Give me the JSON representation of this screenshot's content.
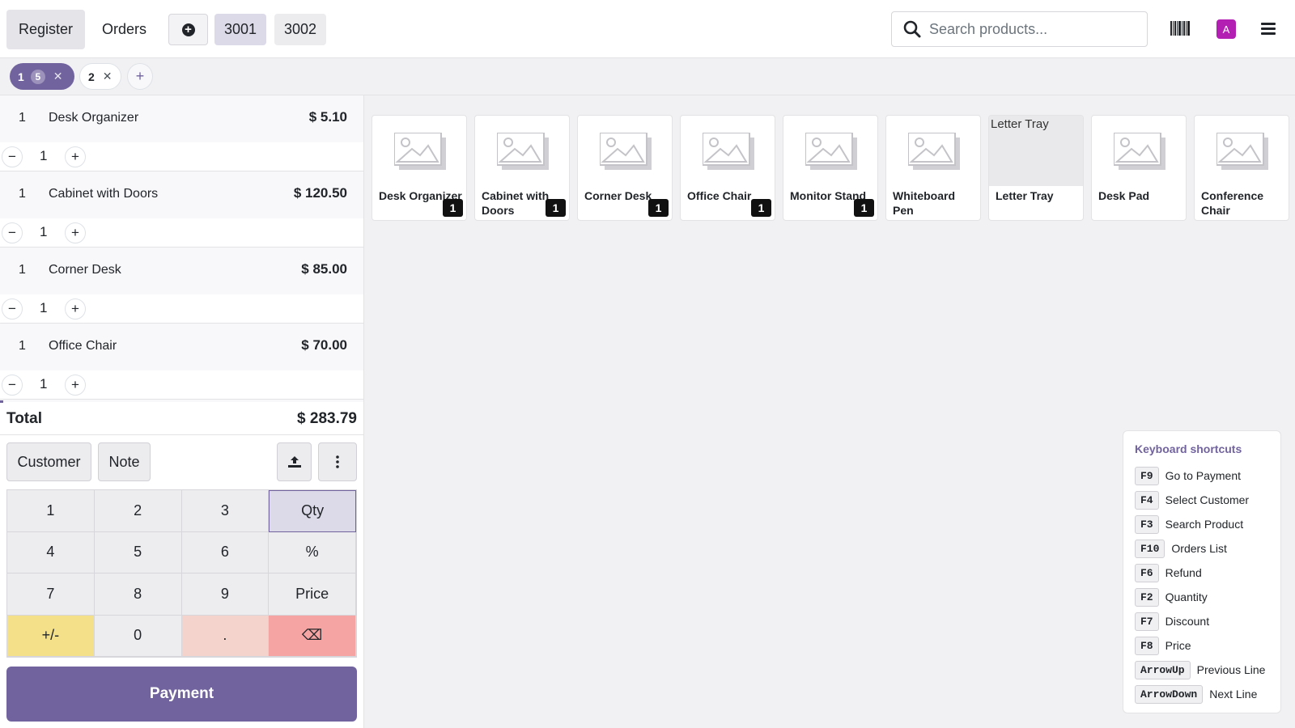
{
  "header": {
    "register_label": "Register",
    "orders_label": "Orders",
    "order_tabs": [
      "3001",
      "3002"
    ],
    "search_placeholder": "Search products...",
    "avatar_letter": "A"
  },
  "order_tabs_bar": {
    "active_tab": {
      "number": "1",
      "count": "5"
    },
    "other_tab": {
      "number": "2"
    }
  },
  "order_lines": [
    {
      "qty": "1",
      "name": "Desk Organizer",
      "price": "$ 5.10",
      "stepper_value": "1"
    },
    {
      "qty": "1",
      "name": "Cabinet with Doors",
      "price": "$ 120.50",
      "stepper_value": "1"
    },
    {
      "qty": "1",
      "name": "Corner Desk",
      "price": "$ 85.00",
      "stepper_value": "1"
    },
    {
      "qty": "1",
      "name": "Office Chair",
      "price": "$ 70.00",
      "stepper_value": "1"
    }
  ],
  "total": {
    "label": "Total",
    "amount": "$ 283.79"
  },
  "controls": {
    "customer_label": "Customer",
    "note_label": "Note"
  },
  "numpad": {
    "keys": [
      "1",
      "2",
      "3",
      "Qty",
      "4",
      "5",
      "6",
      "%",
      "7",
      "8",
      "9",
      "Price",
      "+/-",
      "0",
      ".",
      "⌫"
    ],
    "selected_mode": "Qty"
  },
  "payment_label": "Payment",
  "products": [
    {
      "name": "Desk Organizer",
      "badge": "1",
      "image": "placeholder"
    },
    {
      "name": "Cabinet with Doors",
      "badge": "1",
      "image": "placeholder"
    },
    {
      "name": "Corner Desk",
      "badge": "1",
      "image": "placeholder"
    },
    {
      "name": "Office Chair",
      "badge": "1",
      "image": "placeholder"
    },
    {
      "name": "Monitor Stand",
      "badge": "1",
      "image": "placeholder"
    },
    {
      "name": "Whiteboard Pen",
      "badge": "",
      "image": "placeholder"
    },
    {
      "name": "Letter Tray",
      "badge": "",
      "image": "broken",
      "alt": "Letter Tray"
    },
    {
      "name": "Desk Pad",
      "badge": "",
      "image": "placeholder"
    },
    {
      "name": "Conference Chair",
      "badge": "",
      "image": "placeholder"
    }
  ],
  "shortcuts": {
    "title": "Keyboard shortcuts",
    "items": [
      {
        "key": "F9",
        "action": "Go to Payment"
      },
      {
        "key": "F4",
        "action": "Select Customer"
      },
      {
        "key": "F3",
        "action": "Search Product"
      },
      {
        "key": "F10",
        "action": "Orders List"
      },
      {
        "key": "F6",
        "action": "Refund"
      },
      {
        "key": "F2",
        "action": "Quantity"
      },
      {
        "key": "F7",
        "action": "Discount"
      },
      {
        "key": "F8",
        "action": "Price"
      },
      {
        "key": "ArrowUp",
        "action": "Previous Line"
      },
      {
        "key": "ArrowDown",
        "action": "Next Line"
      }
    ]
  },
  "colors": {
    "accent": "#71639e",
    "avatar": "#b31eb3",
    "numpad_plusminus": "#f5e08a",
    "numpad_dot": "#f4d3cc",
    "numpad_backspace": "#f5a3a3"
  }
}
